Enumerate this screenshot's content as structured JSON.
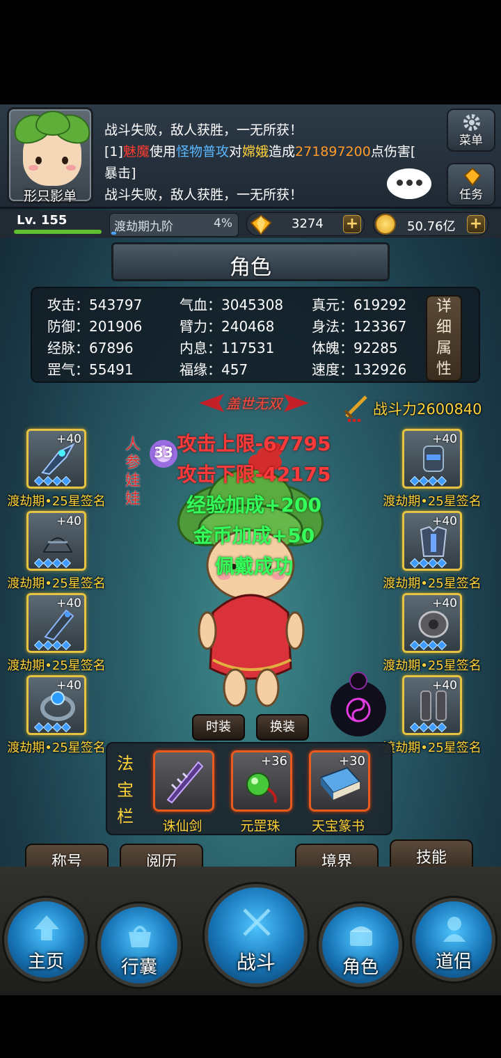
{
  "header": {
    "avatar_name": "形只影单",
    "chat": {
      "line1": "战斗失败，敌人获胜，一无所获！",
      "line2_prefix": "[1]",
      "line2_attacker": "魅魔",
      "line2_use": "使用",
      "line2_skill": "怪物普攻",
      "line2_to": "对",
      "line2_target": "嫦娥",
      "line2_made": "造成",
      "line2_damage": "271897200",
      "line2_suffix": "点伤害[",
      "line3": "暴击]",
      "line4": "战斗失败，敌人获胜，一无所获！"
    },
    "menu_label": "菜单",
    "task_label": "任务"
  },
  "status": {
    "level_label": "Lv. 155",
    "level_progress": 1.0,
    "realm": "渡劫期九阶",
    "realm_pct": "4%",
    "realm_progress": 0.04,
    "gems": "3274",
    "gold": "50.76亿"
  },
  "title": "角色",
  "stats": {
    "attack": "攻击：543797",
    "defense": "防御：201906",
    "meridian": "经脉：67896",
    "gangqi": "罡气：55491",
    "hp": "气血：3045308",
    "arm": "臂力：240468",
    "breath": "内息：117531",
    "luck": "福缘：457",
    "true_yuan": "真元：619292",
    "agility": "身法：123367",
    "physique": "体魄：92285",
    "speed": "速度：132926",
    "detail_chars": [
      "详",
      "细",
      "属",
      "性"
    ]
  },
  "title_badge": "盖世无双",
  "power": "战斗力2600840",
  "character": {
    "name": "人参娃娃",
    "rank": "33"
  },
  "float_texts": {
    "atk_max": "攻击上限-67795",
    "atk_min": "攻击下限-42175",
    "exp_bonus": "经验加成+200",
    "gold_bonus": "金币加成+50",
    "equip_ok": "佩戴成功"
  },
  "equipment_left": [
    {
      "level": "+40",
      "caption": "渡劫期•25星签名",
      "icon": "claw-weapon-icon"
    },
    {
      "level": "+40",
      "caption": "渡劫期•25星签名",
      "icon": "helmet-icon"
    },
    {
      "level": "+40",
      "caption": "渡劫期•25星签名",
      "icon": "gauntlet-icon"
    },
    {
      "level": "+40",
      "caption": "渡劫期•25星签名",
      "icon": "ring-icon"
    }
  ],
  "equipment_right": [
    {
      "level": "+40",
      "caption": "渡劫期•25星签名",
      "icon": "boots-icon"
    },
    {
      "level": "+40",
      "caption": "渡劫期•25星签名",
      "icon": "armor-icon"
    },
    {
      "level": "+40",
      "caption": "渡劫期•25星签名",
      "icon": "amulet-icon"
    },
    {
      "level": "+40",
      "caption": "渡劫期•25星签名",
      "icon": "greaves-icon"
    }
  ],
  "buttons": {
    "fashion": "时装",
    "swap": "换装"
  },
  "treasure": {
    "label_chars": [
      "法",
      "宝",
      "栏"
    ],
    "slots": [
      {
        "level": "",
        "caption": "诛仙剑",
        "icon": "sword-icon"
      },
      {
        "level": "+36",
        "caption": "元罡珠",
        "icon": "orb-icon"
      },
      {
        "level": "+30",
        "caption": "天宝篆书",
        "icon": "book-icon"
      }
    ]
  },
  "menu": {
    "title_btn": "称号",
    "history_btn": "阅历",
    "realm_btn": "境界",
    "skill_btn": "技能"
  },
  "nav": {
    "home": "主页",
    "bag": "行囊",
    "battle": "战斗",
    "role": "角色",
    "companion": "道侣"
  },
  "colors": {
    "gold_text": "#ffd23a",
    "equip_border": "#e6c340",
    "treasure_border": "#e85a1e",
    "float_red": "#ff3a3a",
    "float_green": "#35ff5a"
  }
}
